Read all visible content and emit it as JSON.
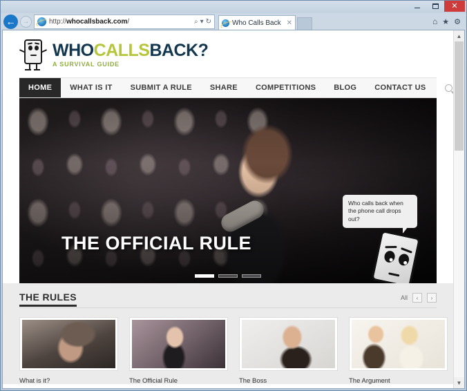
{
  "browser": {
    "window_controls": {
      "minimize": "–",
      "maximize": "□",
      "close": "✕"
    },
    "back_icon": "←",
    "forward_icon": "→",
    "url_scheme": "http://",
    "url_domain": "whocallsback.com",
    "url_path": "/",
    "search_affordance": "⌕",
    "refresh_affordance": "↻",
    "tab_title": "Who Calls Back",
    "tab_close": "✕",
    "home_icon": "⌂",
    "favorites_icon": "★",
    "settings_icon": "⚙"
  },
  "site": {
    "logo": {
      "word_who": "WHO",
      "word_calls": "CALLS",
      "word_back": "BACK?",
      "tagline": "A SURVIVAL GUIDE",
      "navy": "#13374f",
      "lime": "#b5c63b",
      "green": "#8fae3c"
    },
    "nav": {
      "items": [
        {
          "label": "HOME",
          "active": true
        },
        {
          "label": "WHAT IS IT",
          "active": false
        },
        {
          "label": "SUBMIT A RULE",
          "active": false
        },
        {
          "label": "SHARE",
          "active": false
        },
        {
          "label": "COMPETITIONS",
          "active": false
        },
        {
          "label": "BLOG",
          "active": false
        },
        {
          "label": "CONTACT US",
          "active": false
        }
      ],
      "search_icon": "search-icon"
    },
    "hero": {
      "title": "THE OFFICIAL RULE",
      "speech_bubble": "Who calls back when the phone call drops out?",
      "slide_count": 3,
      "active_slide": 1
    },
    "rules": {
      "heading": "THE RULES",
      "filter_label": "All",
      "prev_arrow": "‹",
      "next_arrow": "›",
      "cards": [
        {
          "caption": "What is it?"
        },
        {
          "caption": "The Official Rule"
        },
        {
          "caption": "The Boss"
        },
        {
          "caption": "The Argument"
        }
      ]
    }
  }
}
